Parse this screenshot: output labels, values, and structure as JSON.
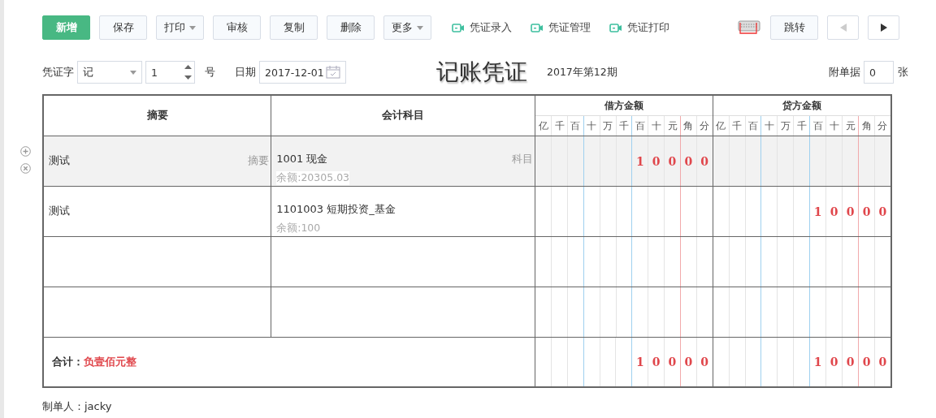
{
  "toolbar": {
    "buttons": [
      {
        "label": "新增",
        "kind": "primary"
      },
      {
        "label": "保存",
        "kind": "plain"
      },
      {
        "label": "打印",
        "kind": "dropdown"
      },
      {
        "label": "审核",
        "kind": "plain"
      },
      {
        "label": "复制",
        "kind": "plain"
      },
      {
        "label": "删除",
        "kind": "plain"
      },
      {
        "label": "更多",
        "kind": "dropdown"
      }
    ],
    "links": [
      "凭证录入",
      "凭证管理",
      "凭证打印"
    ],
    "jump_button": "跳转",
    "prev_disabled": true,
    "next_disabled": false
  },
  "header": {
    "word_label": "凭证字",
    "word": "记",
    "number": "1",
    "number_suffix": "号",
    "date_label": "日期",
    "date": "2017-12-01",
    "title": "记账凭证",
    "period": "2017年第12期",
    "attach_label": "附单据",
    "attachments": "0",
    "attach_suffix": "张"
  },
  "table": {
    "columns": {
      "summary": "摘要",
      "account": "会计科目",
      "debit": "借方金额",
      "credit": "贷方金额",
      "debit_digits": [
        "亿",
        "千",
        "百",
        "十",
        "万",
        "千",
        "百",
        "十",
        "元",
        "角",
        "分"
      ],
      "credit_digits": [
        "亿",
        "千",
        "百",
        "十",
        "万",
        "千",
        "百",
        "十",
        "元",
        "角",
        "分"
      ]
    },
    "rows": [
      {
        "summary": "测试",
        "summary_hint": "摘要",
        "account": "1001 现金",
        "account_hint": "科目",
        "balance": "余额:20305.03",
        "debit": [
          "1",
          "0",
          "0",
          "0",
          "0"
        ],
        "active": true
      },
      {
        "summary": "测试",
        "account": "1101003 短期投资_基金",
        "balance": "余额:100",
        "credit": [
          "1",
          "0",
          "0",
          "0",
          "0"
        ],
        "active": false
      },
      {
        "active": false
      },
      {
        "active": false
      }
    ],
    "total": {
      "label": "合计：",
      "words": "负壹佰元整",
      "debit": [
        "1",
        "0",
        "0",
        "0",
        "0"
      ],
      "credit": [
        "1",
        "0",
        "0",
        "0",
        "0"
      ]
    }
  },
  "footer": {
    "maker": "制单人：jacky"
  }
}
